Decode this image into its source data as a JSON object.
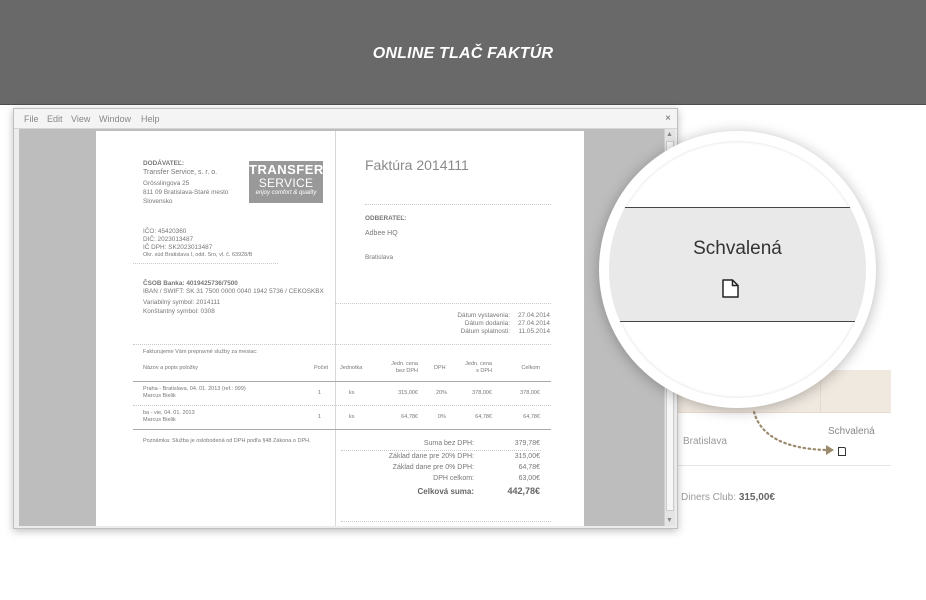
{
  "banner": {
    "title": "ONLINE TLAČ FAKTÚR"
  },
  "window": {
    "menu": [
      "File",
      "Edit",
      "View",
      "Window",
      "Help"
    ],
    "close": "×"
  },
  "invoice": {
    "supplier_label": "DODÁVATEĽ:",
    "supplier_name": "Transfer Service, s. r. o.",
    "supplier_street": "Grösslingova 25",
    "supplier_city": "811 09 Bratislava-Staré mesto",
    "supplier_country": "Slovensko",
    "logo_line1": "TRANSFER",
    "logo_line2": "SERVICE",
    "logo_tagline": "enjoy comfort & quality",
    "ico": "IČO: 45420360",
    "dic": "DIČ: 2023013487",
    "icdph": "IČ DPH: SK2023013487",
    "registry": "Okr. súd Bratislava I, odd. Sro, vl. č. 63928/B",
    "bank": "ČSOB Banka: 4019425736/7500",
    "iban": "IBAN / SWIFT: SK 31 7500 0000 0040 1942 5736 / CEKOSKBX",
    "var_symbol": "Variabilný symbol: 2014111",
    "const_symbol": "Konštantný symbol: 0308",
    "title": "Faktúra 2014111",
    "customer_label": "ODBERATEĽ:",
    "customer_name": "Adbee HQ",
    "customer_city": "Bratislava",
    "dates": [
      {
        "label": "Dátum vystavenia:",
        "value": "27.04.2014"
      },
      {
        "label": "Dátum dodania:",
        "value": "27.04.2014"
      },
      {
        "label": "Dátum splatnosti:",
        "value": "11.05.2014"
      }
    ],
    "intro": "Fakturujeme Vám prepravné služby za mesiac:",
    "columns": {
      "name": "Názov a popis položky",
      "qty": "Počet",
      "unit": "Jednotka",
      "price_excl_l1": "Jedn. cena",
      "price_excl_l2": "bez DPH",
      "vat": "DPH",
      "price_incl_l1": "Jedn. cena",
      "price_incl_l2": "s DPH",
      "total": "Celkom"
    },
    "rows": [
      {
        "name": "Praha - Bratislava, 04. 01. 2013 (ref.: 999)",
        "sub": "Marcus Bielik",
        "qty": "1",
        "unit": "ks",
        "price": "315,00€",
        "vat": "20%",
        "price_vat": "378,00€",
        "total": "378,00€"
      },
      {
        "name": "ba - vie, 04. 01. 2013",
        "sub": "Marcus Bielik",
        "qty": "1",
        "unit": "ks",
        "price": "64,78€",
        "vat": "0%",
        "price_vat": "64,78€",
        "total": "64,78€"
      }
    ],
    "note": "Poznámka: Služba je oslobodená od DPH podľa §48 Zákona o DPH.",
    "summary": [
      {
        "label": "Suma bez DPH:",
        "value": "379,78€"
      },
      {
        "label": "Základ dane pre 20% DPH:",
        "value": "315,00€"
      },
      {
        "label": "Základ dane pre 0% DPH:",
        "value": "64,78€"
      },
      {
        "label": "DPH celkom:",
        "value": "63,00€"
      }
    ],
    "grand_label": "Celková suma:",
    "grand_value": "442,78€"
  },
  "background": {
    "city": "Bratislava",
    "status": "Schvalená",
    "payment_label": "Diners Club:",
    "payment_value": "315,00€"
  },
  "magnifier": {
    "status": "Schvalená",
    "icon": "document-icon"
  }
}
